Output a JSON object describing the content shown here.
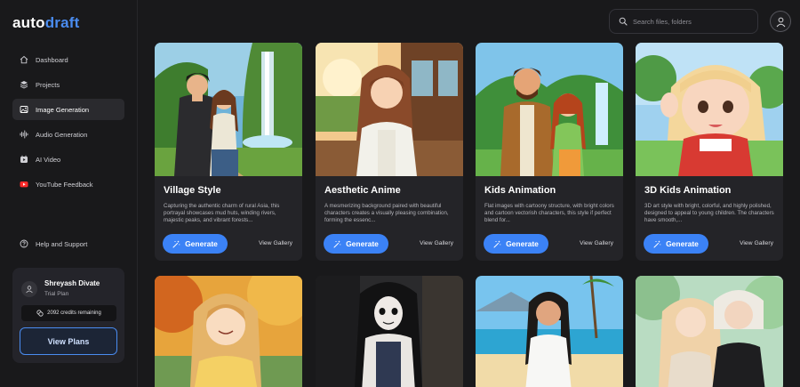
{
  "brand": {
    "logo_prefix": "auto",
    "logo_suffix": "draft",
    "accent_color": "#4a8cf0"
  },
  "sidebar": {
    "items": [
      {
        "label": "Dashboard",
        "icon": "home-icon",
        "active": false
      },
      {
        "label": "Projects",
        "icon": "layers-icon",
        "active": false
      },
      {
        "label": "Image Generation",
        "icon": "image-icon",
        "active": true
      },
      {
        "label": "Audio Generation",
        "icon": "waveform-icon",
        "active": false
      },
      {
        "label": "AI Video",
        "icon": "video-icon",
        "active": false
      },
      {
        "label": "YouTube Feedback",
        "icon": "youtube-icon",
        "active": false
      }
    ],
    "help_label": "Help and Support",
    "user": {
      "name": "Shreyash Divate",
      "plan": "Trial Plan",
      "credits": "2092 credits remaining",
      "view_plans_label": "View Plans"
    }
  },
  "header": {
    "search_placeholder": "Search files, folders"
  },
  "styles": [
    {
      "title": "Village Style",
      "description": "Capturing the authentic charm of rural Asia, this portrayal showcases mud huts, winding rivers, majestic peaks, and vibrant forests...",
      "generate_label": "Generate",
      "gallery_label": "View Gallery"
    },
    {
      "title": "Aesthetic Anime",
      "description": "A mesmerizing background paired with beautiful characters creates a visually pleasing combination, forming the essenc...",
      "generate_label": "Generate",
      "gallery_label": "View Gallery"
    },
    {
      "title": "Kids Animation",
      "description": "Flat images with cartoony structure, with bright colors and cartoon vectorish characters, this style if perfect blend for...",
      "generate_label": "Generate",
      "gallery_label": "View Gallery"
    },
    {
      "title": "3D Kids Animation",
      "description": "3D art style with bright, colorful, and highly polished, designed to appeal to young children. The characters have smooth,...",
      "generate_label": "Generate",
      "gallery_label": "View Gallery"
    }
  ]
}
